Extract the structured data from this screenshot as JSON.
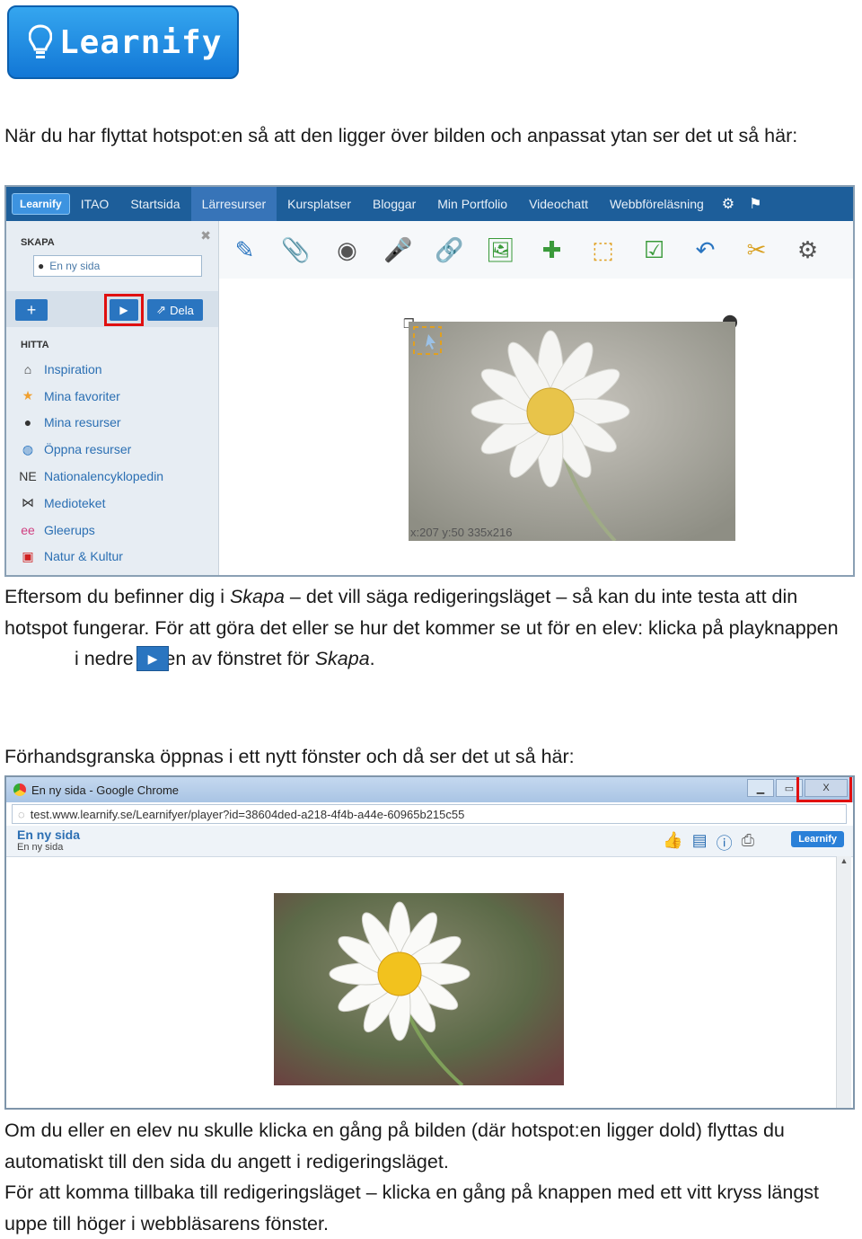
{
  "logo": {
    "text": "Learnify"
  },
  "para1": "När du har flyttat hotspot:en så att den ligger över bilden och anpassat ytan ser det ut så här:",
  "editor": {
    "nav_logo": "Learnify",
    "nav": [
      "ITAO",
      "Startsida",
      "Lärresurser",
      "Kursplatser",
      "Bloggar",
      "Min Portfolio",
      "Videochatt",
      "Webbföreläsning"
    ],
    "skapa_header": "SKAPA",
    "page_name": "En ny sida",
    "add_label": "+",
    "play_label": "▶",
    "share_label": "Dela",
    "hitta_header": "HITTA",
    "hitta_items": [
      {
        "label": "Inspiration",
        "icon": "home-icon",
        "glyph": "⌂",
        "color": "#333333"
      },
      {
        "label": "Mina favoriter",
        "icon": "star-icon",
        "glyph": "★",
        "color": "#f0a030"
      },
      {
        "label": "Mina resurser",
        "icon": "user-icon",
        "glyph": "●",
        "color": "#333333"
      },
      {
        "label": "Öppna resurser",
        "icon": "globe-icon",
        "glyph": "◍",
        "color": "#2a75c0"
      },
      {
        "label": "Nationalencyklopedin",
        "icon": "ne-icon",
        "glyph": "NE",
        "color": "#333333"
      },
      {
        "label": "Medioteket",
        "icon": "network-icon",
        "glyph": "⋈",
        "color": "#333333"
      },
      {
        "label": "Gleerups",
        "icon": "gleerups-icon",
        "glyph": "ee",
        "color": "#d04080"
      },
      {
        "label": "Natur & Kultur",
        "icon": "natur-kultur-icon",
        "glyph": "▣",
        "color": "#d02020"
      }
    ],
    "tools": [
      {
        "icon": "pencil-icon",
        "glyph": "✎",
        "color": "#2a75c0"
      },
      {
        "icon": "paperclip-icon",
        "glyph": "📎",
        "color": "#d9a020"
      },
      {
        "icon": "webcam-icon",
        "glyph": "◉",
        "color": "#555555"
      },
      {
        "icon": "microphone-icon",
        "glyph": "🎤",
        "color": "#2a75c0"
      },
      {
        "icon": "link-icon",
        "glyph": "🔗",
        "color": "#d9a020"
      },
      {
        "icon": "image-icon",
        "glyph": "🖼",
        "color": "#3a9a3a"
      },
      {
        "icon": "puzzle-icon",
        "glyph": "✚",
        "color": "#3a9a3a"
      },
      {
        "icon": "hotspot-icon",
        "glyph": "⬚",
        "color": "#e0a020"
      },
      {
        "icon": "checkbox-icon",
        "glyph": "☑",
        "color": "#3a9a3a"
      },
      {
        "icon": "undo-icon",
        "glyph": "↶",
        "color": "#2a75c0"
      },
      {
        "icon": "folder-scissors-icon",
        "glyph": "✂",
        "color": "#d9a020"
      },
      {
        "icon": "gear-icon",
        "glyph": "⚙",
        "color": "#555555"
      }
    ],
    "coords": "x:207 y:50 335x216"
  },
  "para2": {
    "before": "Eftersom du befinner dig i ",
    "skapa1": "Skapa",
    "middle": " – det vill säga redigeringsläget – så kan du inte testa att din hotspot fungerar. För att göra det eller se hur det kommer se ut för en elev: klicka på playknappen",
    "after": " i nedre delen av fönstret för ",
    "skapa2": "Skapa",
    "end": "."
  },
  "para3": "Förhandsgranska öppnas i ett nytt fönster och då ser det ut så här:",
  "preview": {
    "window_title": "En ny sida - Google Chrome",
    "url": "test.www.learnify.se/Learnifyer/player?id=38604ded-a218-4f4b-a44e-60965b215c55",
    "page_title": "En ny sida",
    "page_subtitle": "En ny sida",
    "logo": "Learnify",
    "close_label": "X"
  },
  "para4": "Om du eller en elev nu skulle klicka en gång på bilden (där hotspot:en ligger dold) flyttas du automatiskt till den sida du angett i redigeringsläget.",
  "para5": "För att komma tillbaka till redigeringsläget – klicka en gång på knappen med ett vitt kryss längst uppe till höger i webbläsarens fönster."
}
